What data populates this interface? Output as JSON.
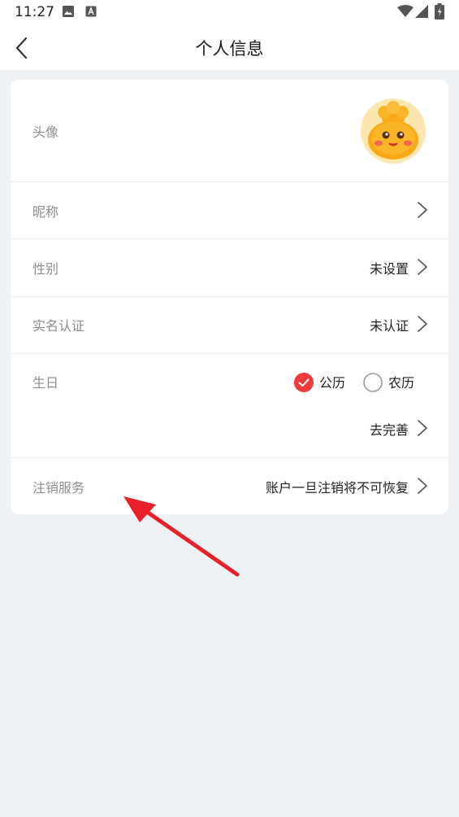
{
  "status_bar": {
    "time": "11:27",
    "left_icons": [
      "image-icon",
      "text-a-icon"
    ],
    "right_icons": [
      "wifi-icon",
      "signal-icon",
      "battery-icon"
    ]
  },
  "header": {
    "title": "个人信息",
    "back_icon": "chevron-left-icon"
  },
  "profile": {
    "avatar": {
      "label": "头像"
    },
    "nickname": {
      "label": "昵称",
      "value": ""
    },
    "gender": {
      "label": "性别",
      "value": "未设置"
    },
    "realname": {
      "label": "实名认证",
      "value": "未认证"
    },
    "birthday": {
      "label": "生日",
      "options": [
        "公历",
        "农历"
      ],
      "selected": "公历",
      "action": "去完善"
    },
    "cancel": {
      "label": "注销服务",
      "value": "账户一旦注销将不可恢复"
    }
  },
  "colors": {
    "accent": "#ef3b3b",
    "background": "#eff2f5",
    "card": "#ffffff",
    "label": "#8c8c8c",
    "annotation_arrow": "#e8202a"
  }
}
